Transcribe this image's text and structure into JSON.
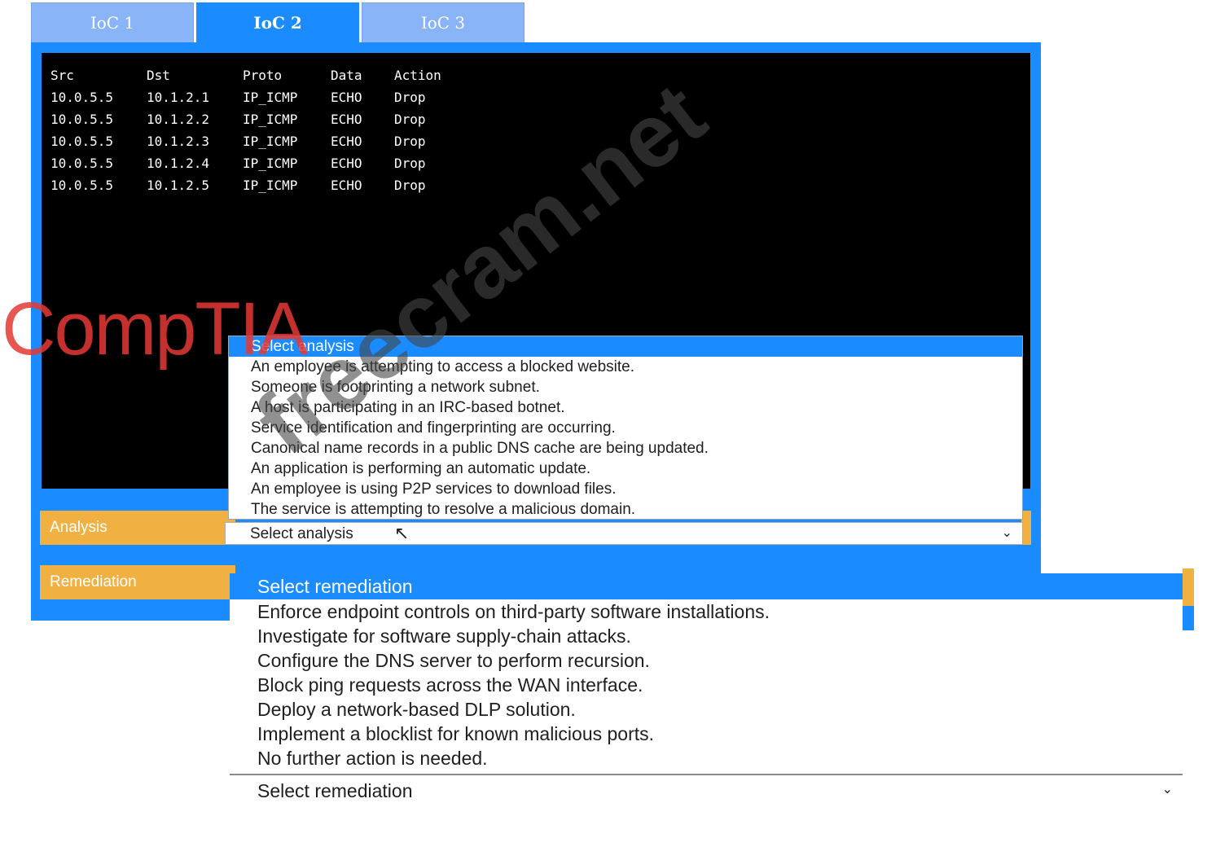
{
  "tabs": [
    {
      "label": "IoC 1"
    },
    {
      "label": "IoC 2"
    },
    {
      "label": "IoC 3"
    }
  ],
  "log": {
    "columns": [
      "Src",
      "Dst",
      "Proto",
      "Data",
      "Action"
    ],
    "rows": [
      [
        "10.0.5.5",
        "10.1.2.1",
        "IP_ICMP",
        "ECHO",
        "Drop"
      ],
      [
        "10.0.5.5",
        "10.1.2.2",
        "IP_ICMP",
        "ECHO",
        "Drop"
      ],
      [
        "10.0.5.5",
        "10.1.2.3",
        "IP_ICMP",
        "ECHO",
        "Drop"
      ],
      [
        "10.0.5.5",
        "10.1.2.4",
        "IP_ICMP",
        "ECHO",
        "Drop"
      ],
      [
        "10.0.5.5",
        "10.1.2.5",
        "IP_ICMP",
        "ECHO",
        "Drop"
      ]
    ]
  },
  "analysis": {
    "label": "Analysis",
    "selected": "Select analysis",
    "options": [
      "Select analysis",
      "An employee is attempting to access a blocked website.",
      "Someone is footprinting a network subnet.",
      "A host is participating in an IRC-based botnet.",
      "Service identification and fingerprinting are occurring.",
      "Canonical name records in a public DNS cache are being updated.",
      "An application is performing an automatic update.",
      "An employee is using P2P services to download files.",
      "The service is attempting to resolve a malicious domain."
    ]
  },
  "remediation": {
    "label": "Remediation",
    "selected": "Select remediation",
    "options": [
      "Select remediation",
      "Enforce endpoint controls on third-party software installations.",
      "Investigate for software supply-chain attacks.",
      "Configure the DNS server to perform recursion.",
      "Block ping requests across the WAN interface.",
      "Deploy a network-based DLP solution.",
      "Implement a blocklist for known malicious ports.",
      "No further action is needed."
    ]
  },
  "overlay": {
    "logo_text": "CompTIA",
    "watermark_text": "freecram.net"
  },
  "colors": {
    "accent_blue": "#1a8cff",
    "tab_inactive": "#8ab4f8",
    "label_orange": "#f0b142",
    "terminal_bg": "#000000",
    "logo_red": "#e53935"
  }
}
